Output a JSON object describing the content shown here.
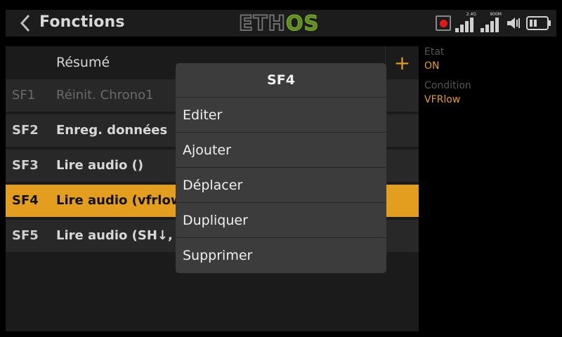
{
  "header": {
    "title": "Fonctions",
    "logo_left": "ETH",
    "logo_right": "OS",
    "signal1_label": "2.4G",
    "signal2_label": "900M"
  },
  "list": {
    "header": "Résumé",
    "add_label": "+",
    "rows": [
      {
        "id": "SF1",
        "text": "Réinit. Chrono1"
      },
      {
        "id": "SF2",
        "text": "Enreg. données"
      },
      {
        "id": "SF3",
        "text": "Lire audio ()"
      },
      {
        "id": "SF4",
        "text": "Lire audio (vfrlow"
      },
      {
        "id": "SF5",
        "text": "Lire audio (SH↓, t"
      }
    ]
  },
  "info": {
    "state_label": "Etat",
    "state_value": "ON",
    "condition_label": "Condition",
    "condition_value": "VFRlow"
  },
  "popup": {
    "title": "SF4",
    "items": [
      "Editer",
      "Ajouter",
      "Déplacer",
      "Dupliquer",
      "Supprimer"
    ]
  },
  "colors": {
    "accent": "#e39d1f",
    "logo_green": "#5e8c23",
    "record_red": "#e01818"
  }
}
